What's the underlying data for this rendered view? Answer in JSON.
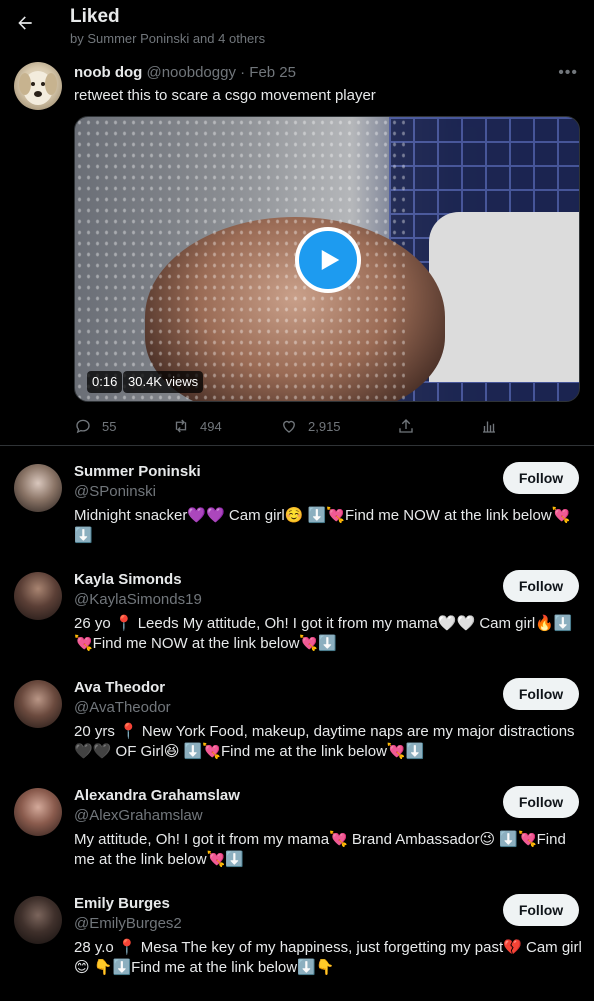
{
  "header": {
    "title": "Liked",
    "subtitle": "by Summer Poninski and 4 others"
  },
  "tweet": {
    "author_name": "noob dog",
    "author_handle": "@noobdoggy",
    "separator": "·",
    "date": "Feb 25",
    "text": "retweet this to scare a csgo movement player",
    "media": {
      "duration": "0:16",
      "views": "30.4K views"
    },
    "actions": {
      "replies": "55",
      "retweets": "494",
      "likes": "2,915"
    }
  },
  "users": [
    {
      "name": "Summer Poninski",
      "handle": "@SPoninski",
      "follow_label": "Follow",
      "bio": "Midnight snacker💜💜 Cam girl☺️ ⬇️💘Find me NOW at the link below💘⬇️"
    },
    {
      "name": "Kayla Simonds",
      "handle": "@KaylaSimonds19",
      "follow_label": "Follow",
      "bio": "26 yo 📍 Leeds My attitude, Oh! I got it from my mama🤍🤍 Cam girl🔥⬇️💘Find me NOW at the link below💘⬇️"
    },
    {
      "name": "Ava Theodor",
      "handle": "@AvaTheodor",
      "follow_label": "Follow",
      "bio": "20 yrs 📍 New York Food, makeup, daytime naps are my major distractions 🖤🖤 OF Girl😆 ⬇️💘Find me at the link below💘⬇️"
    },
    {
      "name": "Alexandra Grahamslaw",
      "handle": "@AlexGrahamslaw",
      "follow_label": "Follow",
      "bio": "My attitude, Oh! I got it from my mama💘 Brand Ambassador😉 ⬇️💘Find me at the link below💘⬇️"
    },
    {
      "name": "Emily Burges",
      "handle": "@EmilyBurges2",
      "follow_label": "Follow",
      "bio": "28 y.o 📍 Mesa The key of my happiness, just forgetting my past💔 Cam girl😊 👇⬇️Find me at the link below⬇️👇"
    }
  ],
  "colors": {
    "background": "#000000",
    "text_primary": "#e7e9ea",
    "text_secondary": "#71767b",
    "accent": "#1d9bf0",
    "follow_bg": "#eff3f4",
    "divider": "#2f3336"
  }
}
